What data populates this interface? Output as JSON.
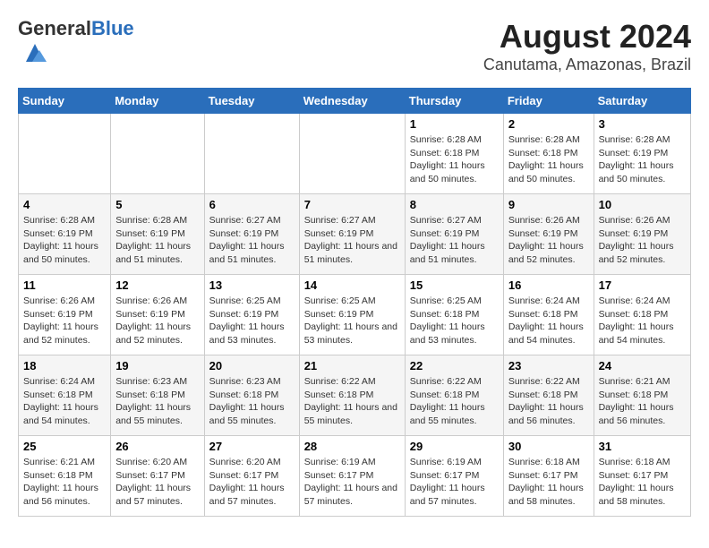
{
  "header": {
    "logo_general": "General",
    "logo_blue": "Blue",
    "main_title": "August 2024",
    "subtitle": "Canutama, Amazonas, Brazil"
  },
  "days_of_week": [
    "Sunday",
    "Monday",
    "Tuesday",
    "Wednesday",
    "Thursday",
    "Friday",
    "Saturday"
  ],
  "weeks": [
    [
      {
        "day": "",
        "sunrise": "",
        "sunset": "",
        "daylight": ""
      },
      {
        "day": "",
        "sunrise": "",
        "sunset": "",
        "daylight": ""
      },
      {
        "day": "",
        "sunrise": "",
        "sunset": "",
        "daylight": ""
      },
      {
        "day": "",
        "sunrise": "",
        "sunset": "",
        "daylight": ""
      },
      {
        "day": "1",
        "sunrise": "Sunrise: 6:28 AM",
        "sunset": "Sunset: 6:18 PM",
        "daylight": "Daylight: 11 hours and 50 minutes."
      },
      {
        "day": "2",
        "sunrise": "Sunrise: 6:28 AM",
        "sunset": "Sunset: 6:18 PM",
        "daylight": "Daylight: 11 hours and 50 minutes."
      },
      {
        "day": "3",
        "sunrise": "Sunrise: 6:28 AM",
        "sunset": "Sunset: 6:19 PM",
        "daylight": "Daylight: 11 hours and 50 minutes."
      }
    ],
    [
      {
        "day": "4",
        "sunrise": "Sunrise: 6:28 AM",
        "sunset": "Sunset: 6:19 PM",
        "daylight": "Daylight: 11 hours and 50 minutes."
      },
      {
        "day": "5",
        "sunrise": "Sunrise: 6:28 AM",
        "sunset": "Sunset: 6:19 PM",
        "daylight": "Daylight: 11 hours and 51 minutes."
      },
      {
        "day": "6",
        "sunrise": "Sunrise: 6:27 AM",
        "sunset": "Sunset: 6:19 PM",
        "daylight": "Daylight: 11 hours and 51 minutes."
      },
      {
        "day": "7",
        "sunrise": "Sunrise: 6:27 AM",
        "sunset": "Sunset: 6:19 PM",
        "daylight": "Daylight: 11 hours and 51 minutes."
      },
      {
        "day": "8",
        "sunrise": "Sunrise: 6:27 AM",
        "sunset": "Sunset: 6:19 PM",
        "daylight": "Daylight: 11 hours and 51 minutes."
      },
      {
        "day": "9",
        "sunrise": "Sunrise: 6:26 AM",
        "sunset": "Sunset: 6:19 PM",
        "daylight": "Daylight: 11 hours and 52 minutes."
      },
      {
        "day": "10",
        "sunrise": "Sunrise: 6:26 AM",
        "sunset": "Sunset: 6:19 PM",
        "daylight": "Daylight: 11 hours and 52 minutes."
      }
    ],
    [
      {
        "day": "11",
        "sunrise": "Sunrise: 6:26 AM",
        "sunset": "Sunset: 6:19 PM",
        "daylight": "Daylight: 11 hours and 52 minutes."
      },
      {
        "day": "12",
        "sunrise": "Sunrise: 6:26 AM",
        "sunset": "Sunset: 6:19 PM",
        "daylight": "Daylight: 11 hours and 52 minutes."
      },
      {
        "day": "13",
        "sunrise": "Sunrise: 6:25 AM",
        "sunset": "Sunset: 6:19 PM",
        "daylight": "Daylight: 11 hours and 53 minutes."
      },
      {
        "day": "14",
        "sunrise": "Sunrise: 6:25 AM",
        "sunset": "Sunset: 6:19 PM",
        "daylight": "Daylight: 11 hours and 53 minutes."
      },
      {
        "day": "15",
        "sunrise": "Sunrise: 6:25 AM",
        "sunset": "Sunset: 6:18 PM",
        "daylight": "Daylight: 11 hours and 53 minutes."
      },
      {
        "day": "16",
        "sunrise": "Sunrise: 6:24 AM",
        "sunset": "Sunset: 6:18 PM",
        "daylight": "Daylight: 11 hours and 54 minutes."
      },
      {
        "day": "17",
        "sunrise": "Sunrise: 6:24 AM",
        "sunset": "Sunset: 6:18 PM",
        "daylight": "Daylight: 11 hours and 54 minutes."
      }
    ],
    [
      {
        "day": "18",
        "sunrise": "Sunrise: 6:24 AM",
        "sunset": "Sunset: 6:18 PM",
        "daylight": "Daylight: 11 hours and 54 minutes."
      },
      {
        "day": "19",
        "sunrise": "Sunrise: 6:23 AM",
        "sunset": "Sunset: 6:18 PM",
        "daylight": "Daylight: 11 hours and 55 minutes."
      },
      {
        "day": "20",
        "sunrise": "Sunrise: 6:23 AM",
        "sunset": "Sunset: 6:18 PM",
        "daylight": "Daylight: 11 hours and 55 minutes."
      },
      {
        "day": "21",
        "sunrise": "Sunrise: 6:22 AM",
        "sunset": "Sunset: 6:18 PM",
        "daylight": "Daylight: 11 hours and 55 minutes."
      },
      {
        "day": "22",
        "sunrise": "Sunrise: 6:22 AM",
        "sunset": "Sunset: 6:18 PM",
        "daylight": "Daylight: 11 hours and 55 minutes."
      },
      {
        "day": "23",
        "sunrise": "Sunrise: 6:22 AM",
        "sunset": "Sunset: 6:18 PM",
        "daylight": "Daylight: 11 hours and 56 minutes."
      },
      {
        "day": "24",
        "sunrise": "Sunrise: 6:21 AM",
        "sunset": "Sunset: 6:18 PM",
        "daylight": "Daylight: 11 hours and 56 minutes."
      }
    ],
    [
      {
        "day": "25",
        "sunrise": "Sunrise: 6:21 AM",
        "sunset": "Sunset: 6:18 PM",
        "daylight": "Daylight: 11 hours and 56 minutes."
      },
      {
        "day": "26",
        "sunrise": "Sunrise: 6:20 AM",
        "sunset": "Sunset: 6:17 PM",
        "daylight": "Daylight: 11 hours and 57 minutes."
      },
      {
        "day": "27",
        "sunrise": "Sunrise: 6:20 AM",
        "sunset": "Sunset: 6:17 PM",
        "daylight": "Daylight: 11 hours and 57 minutes."
      },
      {
        "day": "28",
        "sunrise": "Sunrise: 6:19 AM",
        "sunset": "Sunset: 6:17 PM",
        "daylight": "Daylight: 11 hours and 57 minutes."
      },
      {
        "day": "29",
        "sunrise": "Sunrise: 6:19 AM",
        "sunset": "Sunset: 6:17 PM",
        "daylight": "Daylight: 11 hours and 57 minutes."
      },
      {
        "day": "30",
        "sunrise": "Sunrise: 6:18 AM",
        "sunset": "Sunset: 6:17 PM",
        "daylight": "Daylight: 11 hours and 58 minutes."
      },
      {
        "day": "31",
        "sunrise": "Sunrise: 6:18 AM",
        "sunset": "Sunset: 6:17 PM",
        "daylight": "Daylight: 11 hours and 58 minutes."
      }
    ]
  ]
}
